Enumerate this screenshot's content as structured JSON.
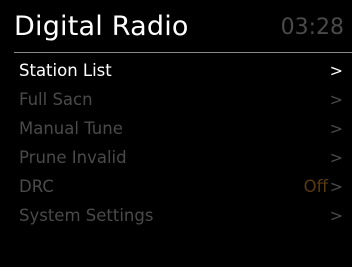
{
  "header": {
    "title": "Digital Radio",
    "clock": "03:28"
  },
  "menu": {
    "items": [
      {
        "label": "Station List",
        "chevron": ">",
        "active": true
      },
      {
        "label": "Full Sacn",
        "chevron": ">",
        "active": false
      },
      {
        "label": "Manual Tune",
        "chevron": ">",
        "active": false
      },
      {
        "label": "Prune Invalid",
        "chevron": ">",
        "active": false
      },
      {
        "label": "DRC",
        "value": "Off",
        "chevron": ">",
        "active": false
      },
      {
        "label": "System Settings",
        "chevron": ">",
        "active": false
      }
    ]
  },
  "colors": {
    "background": "#000000",
    "active_text": "#ffffff",
    "inactive_text": "#4a4a4a",
    "value_text": "#5a3a10",
    "divider": "#8a8a8a"
  }
}
